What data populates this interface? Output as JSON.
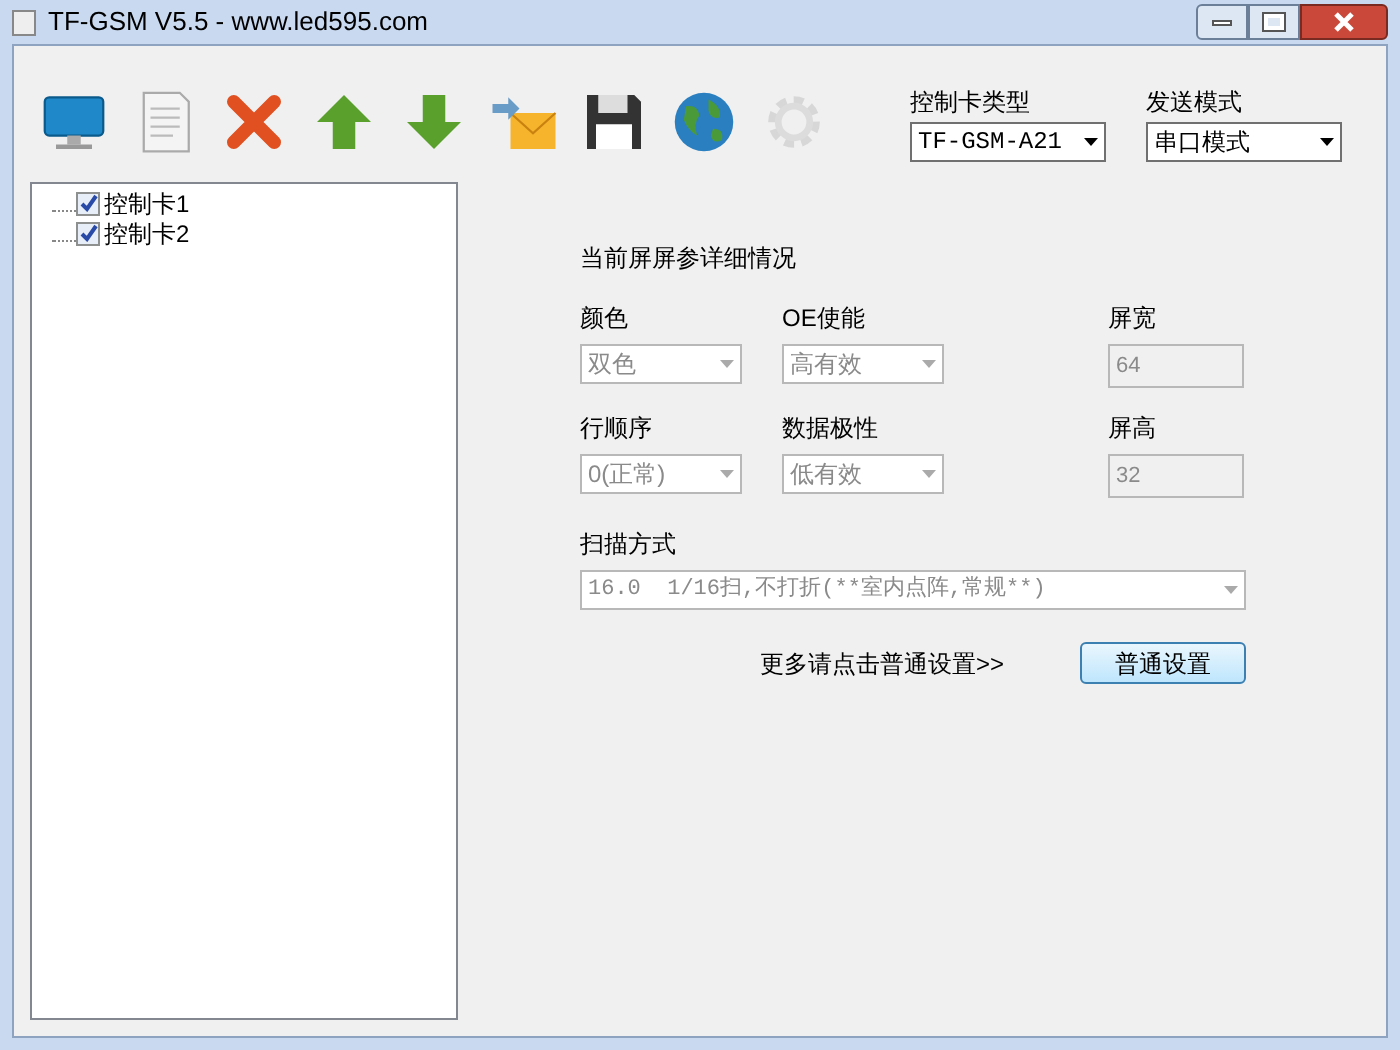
{
  "window": {
    "title": "TF-GSM V5.5 - www.led595.com"
  },
  "toolbar": [
    {
      "kind": "monitor",
      "disabled": false
    },
    {
      "kind": "document",
      "disabled": false
    },
    {
      "kind": "delete",
      "disabled": false
    },
    {
      "kind": "up",
      "disabled": false
    },
    {
      "kind": "down",
      "disabled": false
    },
    {
      "kind": "mail",
      "disabled": false
    },
    {
      "kind": "save",
      "disabled": false
    },
    {
      "kind": "globe",
      "disabled": false
    },
    {
      "kind": "gear",
      "disabled": true
    }
  ],
  "card_type": {
    "label": "控制卡类型",
    "value": "TF-GSM-A21"
  },
  "send_mode": {
    "label": "发送模式",
    "value": "串口模式"
  },
  "tree": [
    {
      "label": "控制卡1",
      "checked": true
    },
    {
      "label": "控制卡2",
      "checked": true
    }
  ],
  "details": {
    "title": "当前屏屏参详细情况",
    "fields": [
      {
        "kind": "combo",
        "label": "颜色",
        "value": "双色",
        "disabled": true
      },
      {
        "kind": "combo",
        "label": "OE使能",
        "value": "高有效",
        "disabled": true
      },
      {
        "kind": "text",
        "label": "屏宽",
        "value": "64",
        "disabled": true
      },
      {
        "kind": "combo",
        "label": "行顺序",
        "value": "0(正常)",
        "disabled": true
      },
      {
        "kind": "combo",
        "label": "数据极性",
        "value": "低有效",
        "disabled": true
      },
      {
        "kind": "text",
        "label": "屏高",
        "value": "32",
        "disabled": true
      }
    ],
    "scan": {
      "label": "扫描方式",
      "value": "16.0  1/16扫,不打折(**室内点阵,常规**)",
      "disabled": true
    },
    "more_hint": "更多请点击普通设置>>",
    "settings_button": "普通设置"
  }
}
